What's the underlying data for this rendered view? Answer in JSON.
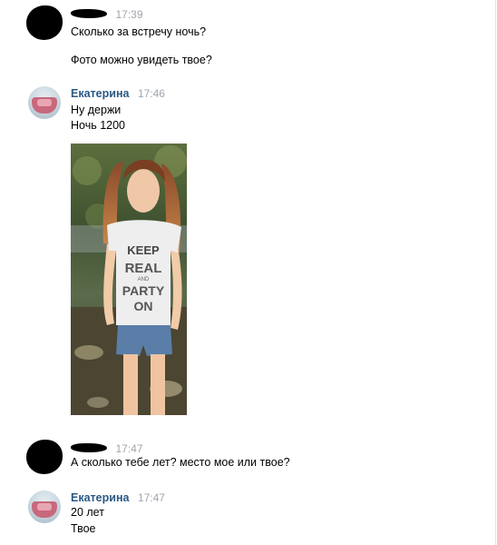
{
  "messages": [
    {
      "sender": "",
      "time": "17:39",
      "lines": [
        "Сколько за встречу ночь?",
        "",
        "Фото можно увидеть твое?"
      ]
    },
    {
      "sender": "Екатерина",
      "time": "17:46",
      "lines": [
        "Ну держи",
        "Ночь 1200"
      ]
    },
    {
      "sender": "",
      "time": "17:47",
      "lines": [
        "А сколько тебе лет? место мое или твое?"
      ]
    },
    {
      "sender": "Екатерина",
      "time": "17:47",
      "lines": [
        "20 лет",
        "Твое"
      ]
    }
  ],
  "attachment": {
    "shirt_text": [
      "KEEP",
      "REAL",
      "AND",
      "PARTY",
      "ON"
    ]
  },
  "colors": {
    "name": "#2a5885",
    "time": "#a0a6ad",
    "text": "#000000"
  }
}
